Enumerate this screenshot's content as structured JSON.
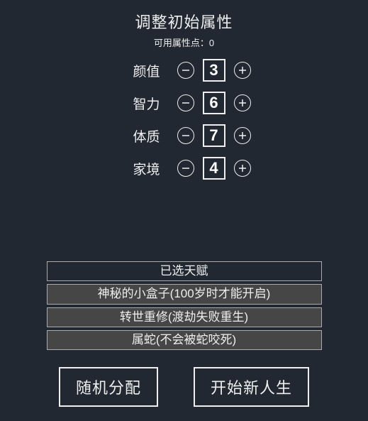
{
  "header": {
    "title": "调整初始属性",
    "available_label": "可用属性点",
    "available_value": 0
  },
  "attributes": [
    {
      "label": "颜值",
      "value": 3
    },
    {
      "label": "智力",
      "value": 6
    },
    {
      "label": "体质",
      "value": 7
    },
    {
      "label": "家境",
      "value": 4
    }
  ],
  "talents": {
    "header": "已选天赋",
    "items": [
      "神秘的小盒子(100岁时才能开启)",
      "转世重修(渡劫失败重生)",
      "属蛇(不会被蛇咬死)"
    ]
  },
  "buttons": {
    "random": "随机分配",
    "start": "开始新人生"
  }
}
